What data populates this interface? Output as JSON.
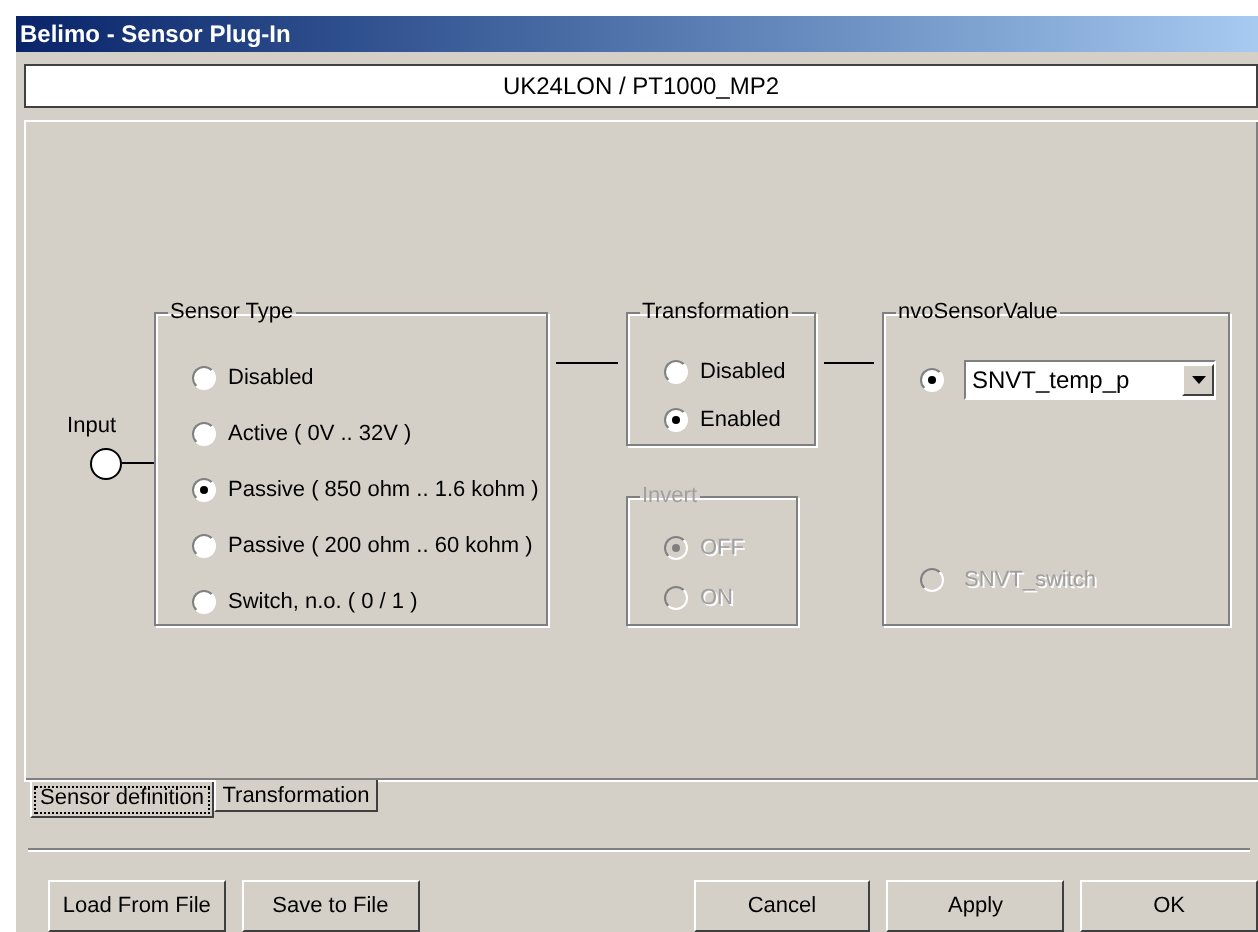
{
  "window": {
    "title": "Belimo - Sensor Plug-In"
  },
  "device": "UK24LON / PT1000_MP2",
  "input": {
    "label": "Input"
  },
  "sensor_type": {
    "title": "Sensor Type",
    "options": [
      {
        "label": "Disabled",
        "selected": false
      },
      {
        "label": "Active ( 0V .. 32V )",
        "selected": false
      },
      {
        "label": "Passive ( 850 ohm .. 1.6 kohm )",
        "selected": true
      },
      {
        "label": "Passive ( 200 ohm .. 60 kohm )",
        "selected": false
      },
      {
        "label": "Switch, n.o. ( 0 / 1 )",
        "selected": false
      }
    ]
  },
  "transformation": {
    "title": "Transformation",
    "options": [
      {
        "label": "Disabled",
        "selected": false
      },
      {
        "label": "Enabled",
        "selected": true
      }
    ]
  },
  "invert": {
    "title": "Invert",
    "disabled": true,
    "options": [
      {
        "label": "OFF",
        "selected": true
      },
      {
        "label": "ON",
        "selected": false
      }
    ]
  },
  "nvo_sensor_value": {
    "title": "nvoSensorValue",
    "options": [
      {
        "kind": "dropdown",
        "value": "SNVT_temp_p",
        "selected": true,
        "disabled": false
      },
      {
        "kind": "plain",
        "label": "SNVT_switch",
        "selected": false,
        "disabled": true
      }
    ]
  },
  "tabs": [
    {
      "label": "Sensor definition",
      "selected": true
    },
    {
      "label": "Transformation",
      "selected": false
    }
  ],
  "buttons": [
    {
      "label": "Load From File"
    },
    {
      "label": "Save to File"
    },
    {
      "label": "Cancel"
    },
    {
      "label": "Apply"
    },
    {
      "label": "OK"
    }
  ]
}
